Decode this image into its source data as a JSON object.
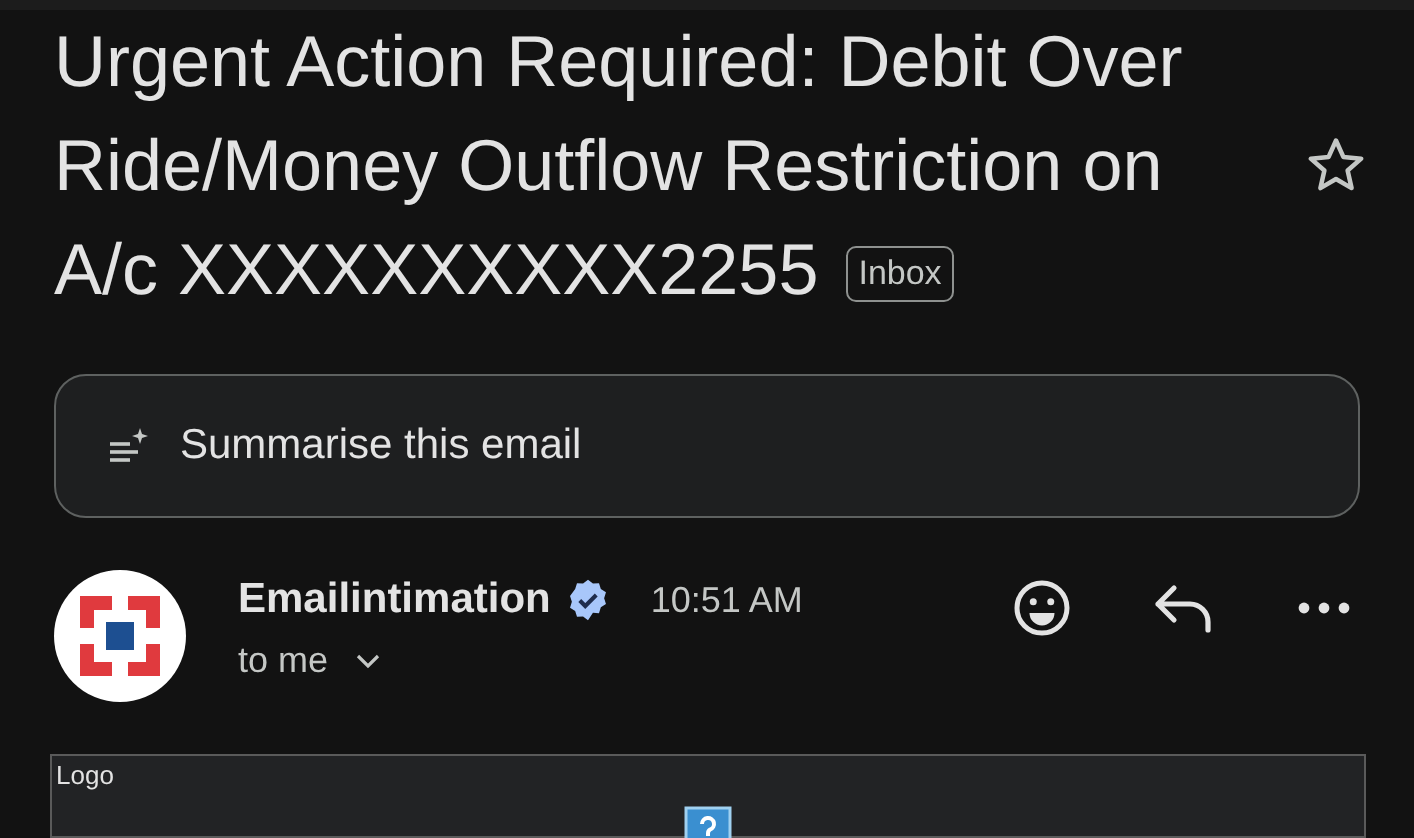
{
  "email": {
    "subject_lines": [
      "Urgent Action Required: Debit Over",
      "Ride/Money Outflow Restriction on",
      "A/c XXXXXXXXXX2255"
    ],
    "label": "Inbox",
    "starred": false
  },
  "summarise_button": {
    "label": "Summarise this email"
  },
  "message": {
    "sender": "Emailintimation",
    "verified": true,
    "time": "10:51 AM",
    "recipient": "to me"
  },
  "body": {
    "image_alt": "Logo"
  }
}
